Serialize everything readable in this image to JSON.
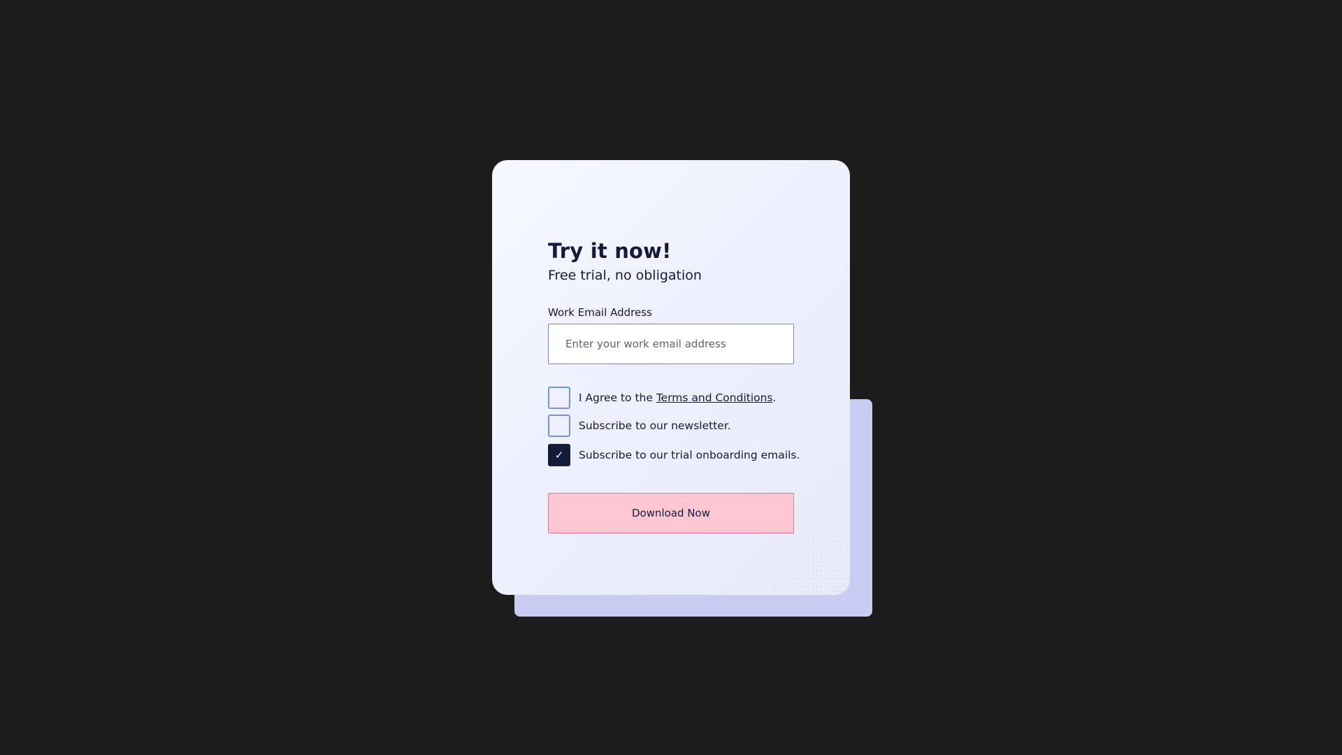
{
  "form": {
    "title": "Try it now!",
    "subtitle": "Free trial, no obligation",
    "email": {
      "label": "Work Email Address",
      "value": "",
      "placeholder": "Enter your work email address"
    },
    "checkboxes": [
      {
        "prefix": "I Agree to the ",
        "link": "Terms and Conditions",
        "suffix": ".",
        "checked": false
      },
      {
        "text": "Subscribe to our newsletter.",
        "checked": false
      },
      {
        "text": "Subscribe to our trial onboarding emails.",
        "checked": true
      }
    ],
    "checkmark": "✓",
    "button_label": "Download Now"
  },
  "colors": {
    "background": "#1c1c1c",
    "card": "#f0f2fd",
    "card_shadow": "#c9cdf3",
    "ink": "#151a3b",
    "checkbox_border": "#7394d6",
    "button_fill": "#fec5d3",
    "button_border": "#e07a8e"
  }
}
